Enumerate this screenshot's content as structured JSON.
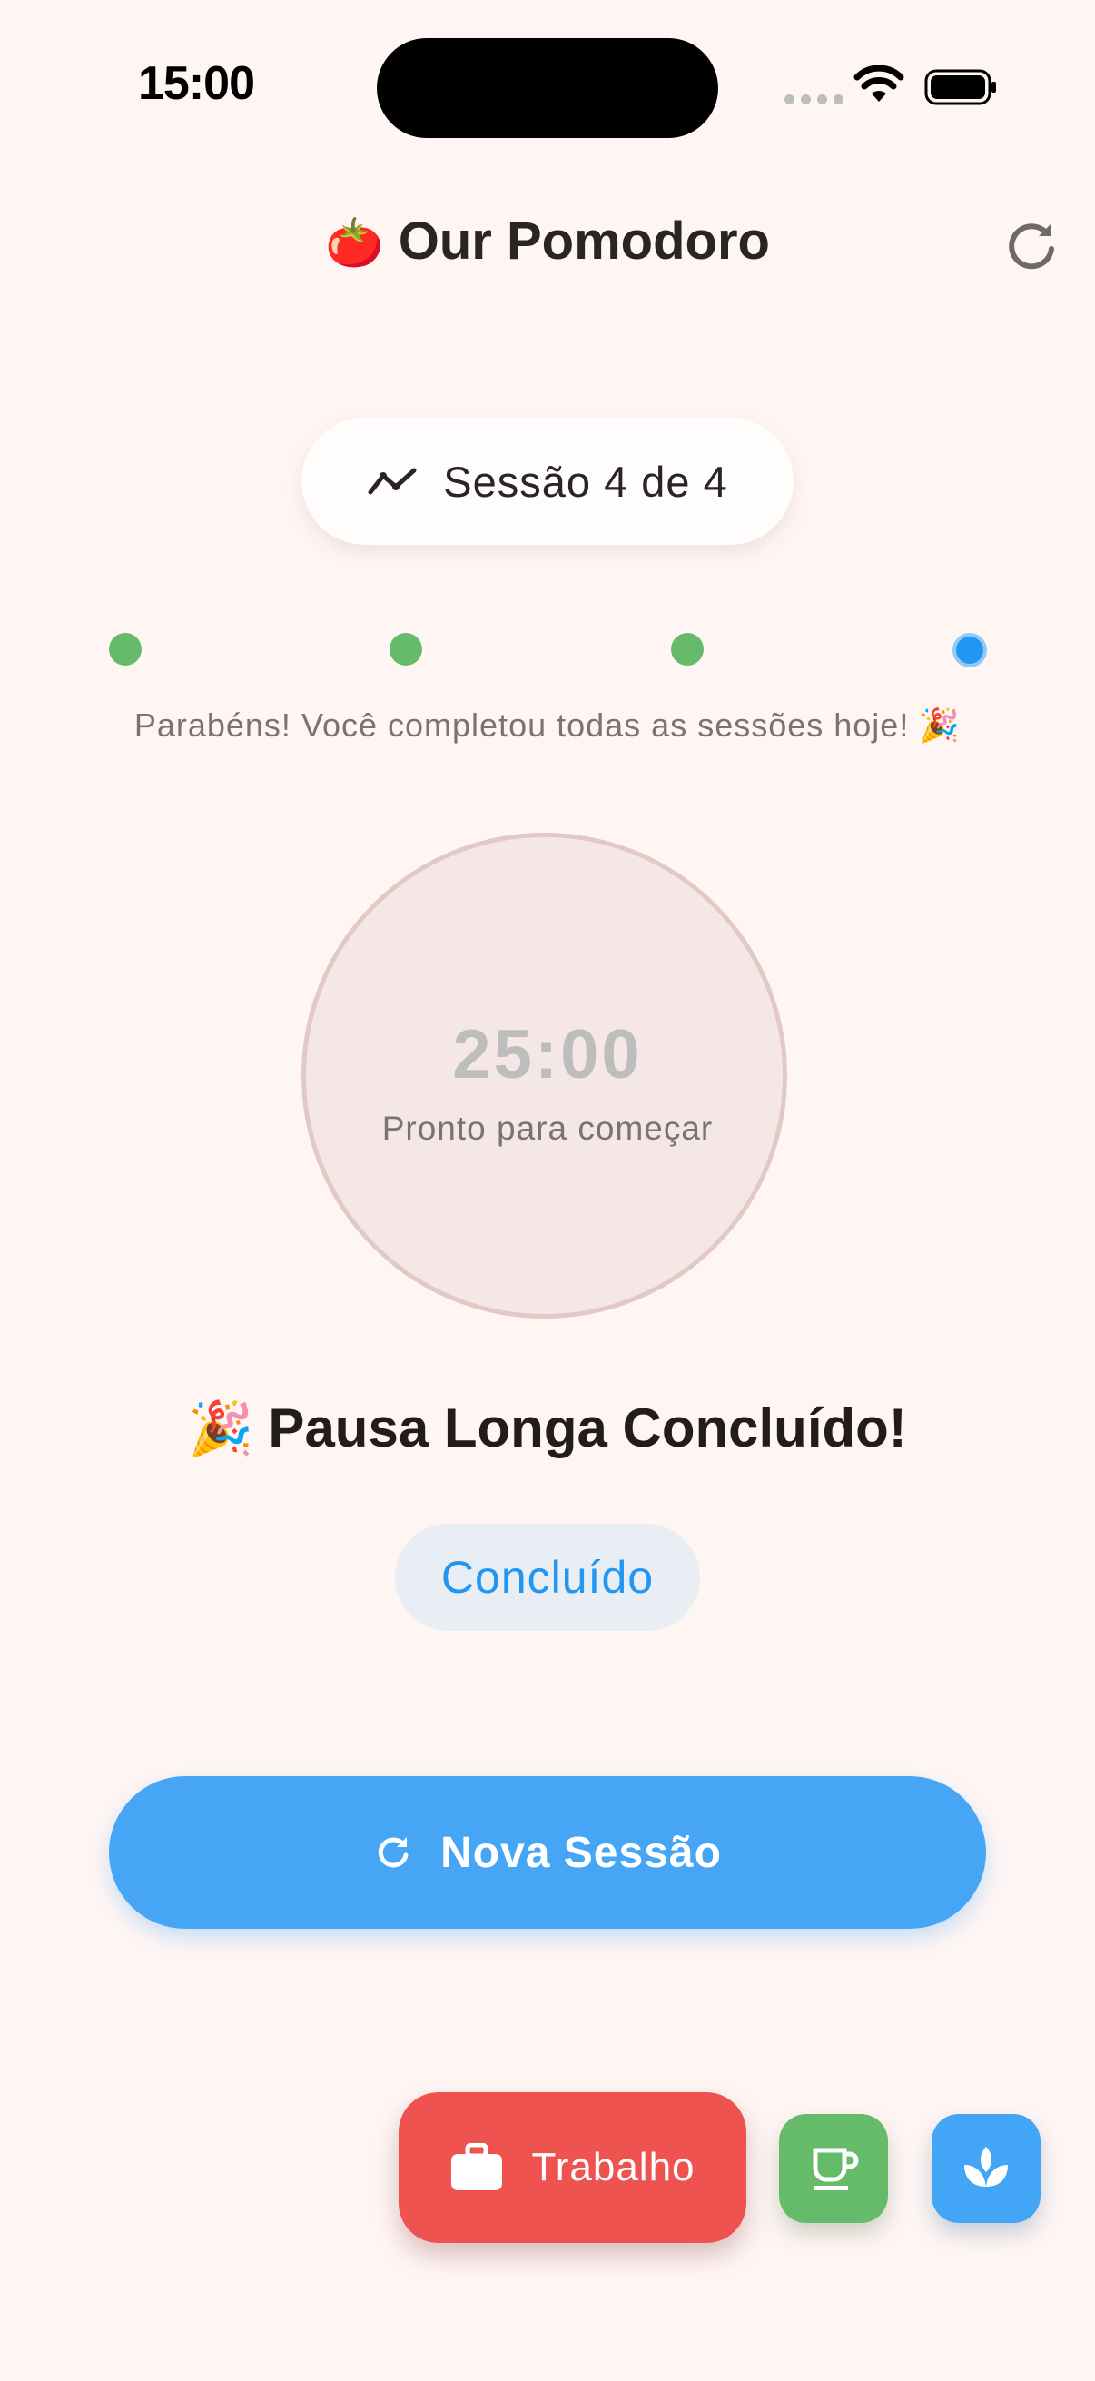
{
  "status_bar": {
    "time": "15:00"
  },
  "header": {
    "tomato_emoji": "🍅",
    "title": "Our Pomodoro",
    "refresh_icon": "refresh-icon"
  },
  "session": {
    "icon": "trend-line-icon",
    "label": "Sessão 4 de 4",
    "completed": 4,
    "total": 4,
    "current_index": 4
  },
  "message": "Parabéns! Você completou todas as sessões hoje! 🎉",
  "timer": {
    "value": "25:00",
    "status": "Pronto para começar"
  },
  "completion": {
    "emoji": "🎉",
    "title": "Pausa Longa Concluído!",
    "chip": "Concluído"
  },
  "primary_button": {
    "icon": "refresh-icon",
    "label": "Nova Sessão"
  },
  "modes": {
    "work": {
      "icon": "briefcase-icon",
      "label": "Trabalho",
      "color": "#ef5350"
    },
    "short_break": {
      "icon": "coffee-icon",
      "color": "#66bb6a"
    },
    "long_break": {
      "icon": "spa-icon",
      "color": "#42a5f5"
    }
  },
  "colors": {
    "background": "#fff6f4",
    "accent": "#2196f3",
    "done_dot": "#66bb6a"
  }
}
